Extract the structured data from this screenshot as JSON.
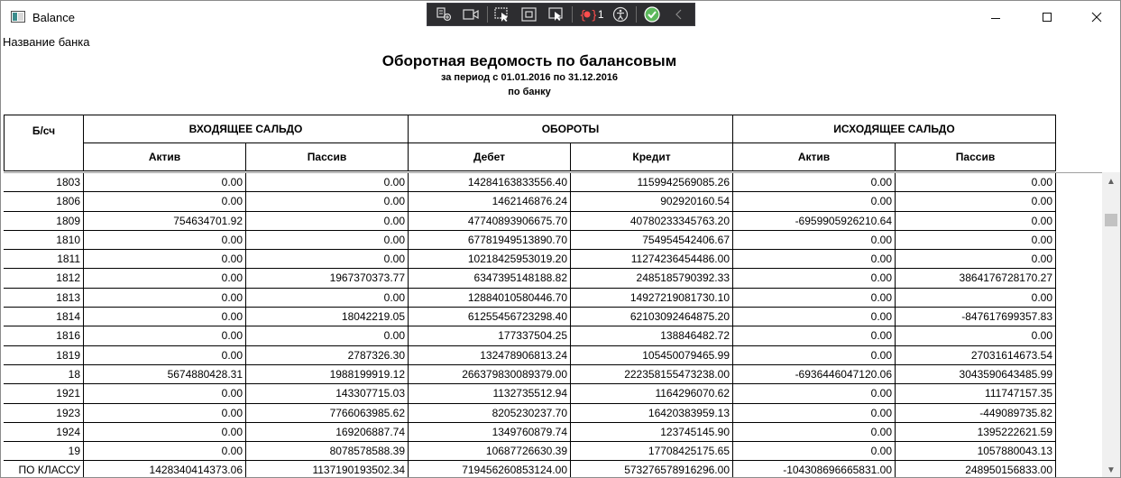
{
  "window": {
    "title": "Balance"
  },
  "devbar": {
    "changed_count": "1"
  },
  "bank_name": "Название банка",
  "report": {
    "title": "Оборотная ведомость по балансовым",
    "period": "за период с 01.01.2016 по 31.12.2016",
    "scope": "по банку"
  },
  "header": {
    "account": "Б/сч",
    "opening": "ВХОДЯЩЕЕ САЛЬДО",
    "turnover": "ОБОРОТЫ",
    "closing": "ИСХОДЯЩЕЕ САЛЬДО",
    "active1": "Актив",
    "passive1": "Пассив",
    "debit": "Дебет",
    "credit": "Кредит",
    "active2": "Актив",
    "passive2": "Пассив"
  },
  "rows": [
    [
      "1803",
      "0.00",
      "0.00",
      "14284163833556.40",
      "1159942569085.26",
      "0.00",
      "0.00"
    ],
    [
      "1806",
      "0.00",
      "0.00",
      "1462146876.24",
      "902920160.54",
      "0.00",
      "0.00"
    ],
    [
      "1809",
      "754634701.92",
      "0.00",
      "47740893906675.70",
      "40780233345763.20",
      "-6959905926210.64",
      "0.00"
    ],
    [
      "1810",
      "0.00",
      "0.00",
      "67781949513890.70",
      "754954542406.67",
      "0.00",
      "0.00"
    ],
    [
      "1811",
      "0.00",
      "0.00",
      "10218425953019.20",
      "11274236454486.00",
      "0.00",
      "0.00"
    ],
    [
      "1812",
      "0.00",
      "1967370373.77",
      "6347395148188.82",
      "2485185790392.33",
      "0.00",
      "3864176728170.27"
    ],
    [
      "1813",
      "0.00",
      "0.00",
      "12884010580446.70",
      "14927219081730.10",
      "0.00",
      "0.00"
    ],
    [
      "1814",
      "0.00",
      "18042219.05",
      "61255456723298.40",
      "62103092464875.20",
      "0.00",
      "-847617699357.83"
    ],
    [
      "1816",
      "0.00",
      "0.00",
      "177337504.25",
      "138846482.72",
      "0.00",
      "0.00"
    ],
    [
      "1819",
      "0.00",
      "2787326.30",
      "132478906813.24",
      "105450079465.99",
      "0.00",
      "27031614673.54"
    ],
    [
      "18",
      "5674880428.31",
      "1988199919.12",
      "266379830089379.00",
      "222358155473238.00",
      "-6936446047120.06",
      "3043590643485.99"
    ],
    [
      "1921",
      "0.00",
      "143307715.03",
      "1132735512.94",
      "1164296070.62",
      "0.00",
      "111747157.35"
    ],
    [
      "1923",
      "0.00",
      "7766063985.62",
      "8205230237.70",
      "16420383959.13",
      "0.00",
      "-449089735.82"
    ],
    [
      "1924",
      "0.00",
      "169206887.74",
      "1349760879.74",
      "123745145.90",
      "0.00",
      "1395222621.59"
    ],
    [
      "19",
      "0.00",
      "8078578588.39",
      "10687726630.39",
      "17708425175.65",
      "0.00",
      "1057880043.13"
    ],
    [
      "ПО КЛАССУ",
      "1428340414373.06",
      "1137190193502.34",
      "719456260853124.00",
      "573276578916296.00",
      "-1043086966658​31.00",
      "248950156833.00"
    ]
  ]
}
